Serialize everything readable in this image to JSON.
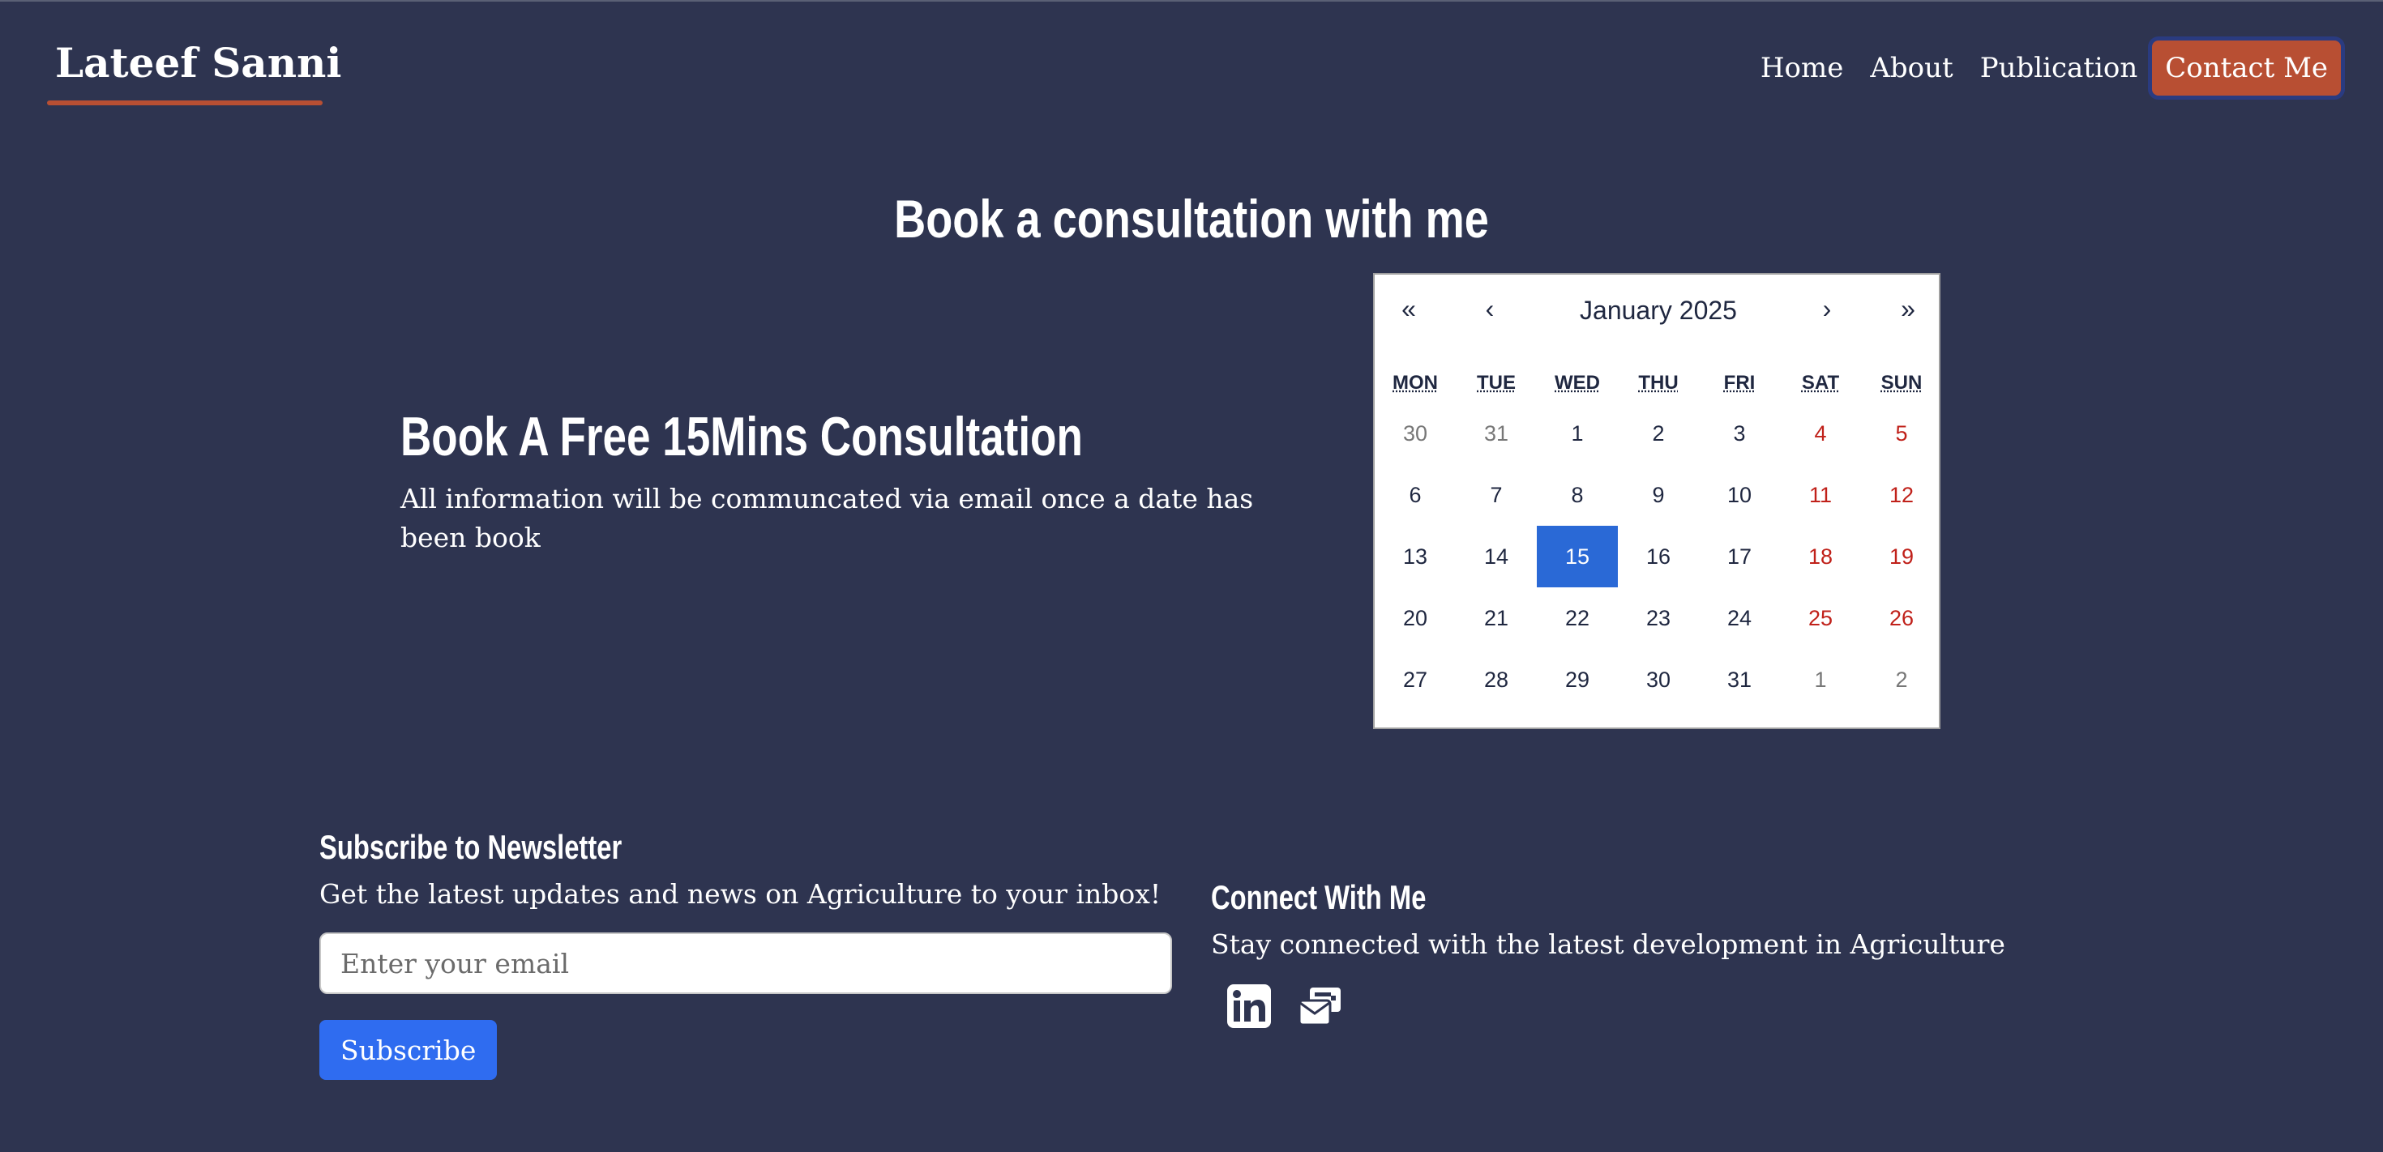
{
  "header": {
    "brand": "Lateef Sanni",
    "nav": [
      {
        "label": "Home"
      },
      {
        "label": "About"
      },
      {
        "label": "Publication"
      }
    ],
    "cta": "Contact Me"
  },
  "page": {
    "title": "Book a consultation with me"
  },
  "consult": {
    "heading": "Book A Free 15Mins Consultation",
    "text": "All information will be communcated via email once a date has been book"
  },
  "calendar": {
    "month_label": "January 2025",
    "nav": {
      "prev_year": "«",
      "prev_month": "‹",
      "next_month": "›",
      "next_year": "»"
    },
    "weekdays": [
      "MON",
      "TUE",
      "WED",
      "THU",
      "FRI",
      "SAT",
      "SUN"
    ],
    "selected_day": "15",
    "days": [
      {
        "d": "30",
        "t": "muted"
      },
      {
        "d": "31",
        "t": "muted"
      },
      {
        "d": "1",
        "t": ""
      },
      {
        "d": "2",
        "t": ""
      },
      {
        "d": "3",
        "t": ""
      },
      {
        "d": "4",
        "t": "weekend"
      },
      {
        "d": "5",
        "t": "weekend"
      },
      {
        "d": "6",
        "t": ""
      },
      {
        "d": "7",
        "t": ""
      },
      {
        "d": "8",
        "t": ""
      },
      {
        "d": "9",
        "t": ""
      },
      {
        "d": "10",
        "t": ""
      },
      {
        "d": "11",
        "t": "weekend"
      },
      {
        "d": "12",
        "t": "weekend"
      },
      {
        "d": "13",
        "t": ""
      },
      {
        "d": "14",
        "t": ""
      },
      {
        "d": "15",
        "t": "selected"
      },
      {
        "d": "16",
        "t": ""
      },
      {
        "d": "17",
        "t": ""
      },
      {
        "d": "18",
        "t": "weekend"
      },
      {
        "d": "19",
        "t": "weekend"
      },
      {
        "d": "20",
        "t": ""
      },
      {
        "d": "21",
        "t": ""
      },
      {
        "d": "22",
        "t": ""
      },
      {
        "d": "23",
        "t": ""
      },
      {
        "d": "24",
        "t": ""
      },
      {
        "d": "25",
        "t": "weekend"
      },
      {
        "d": "26",
        "t": "weekend"
      },
      {
        "d": "27",
        "t": ""
      },
      {
        "d": "28",
        "t": ""
      },
      {
        "d": "29",
        "t": ""
      },
      {
        "d": "30",
        "t": ""
      },
      {
        "d": "31",
        "t": ""
      },
      {
        "d": "1",
        "t": "muted"
      },
      {
        "d": "2",
        "t": "muted"
      }
    ]
  },
  "newsletter": {
    "heading": "Subscribe to Newsletter",
    "text": "Get the latest updates and news on Agriculture to your inbox!",
    "placeholder": "Enter your email",
    "button": "Subscribe"
  },
  "connect": {
    "heading": "Connect With Me",
    "text": "Stay connected with the latest development in Agriculture",
    "icons": [
      "linkedin-icon",
      "email-icon"
    ]
  },
  "colors": {
    "background": "#2e3450",
    "accent": "#b84f33",
    "primary": "#2f6cf0",
    "selected_day": "#2a69d6",
    "weekend": "#c0211a"
  }
}
